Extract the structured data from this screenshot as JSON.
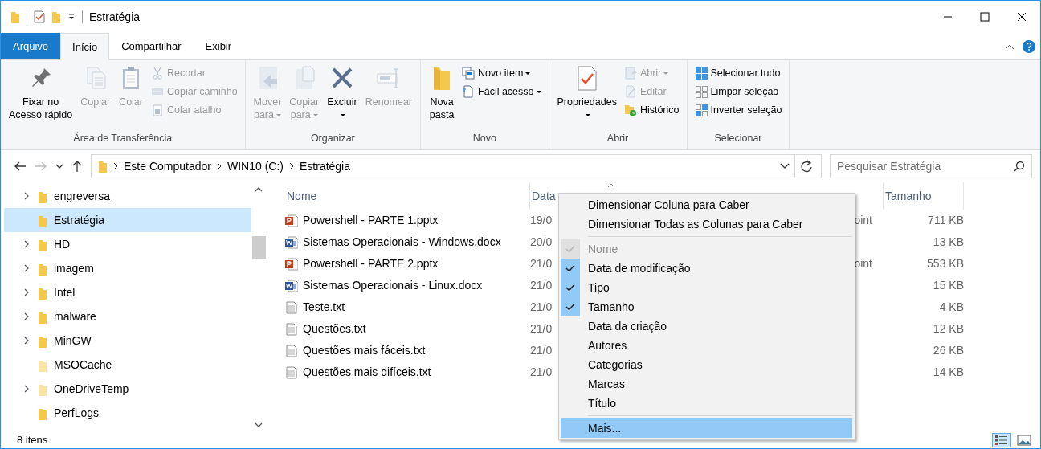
{
  "window": {
    "title": "Estratégia"
  },
  "ribbon_tabs": [
    {
      "label": "Arquivo",
      "kind": "file",
      "selected": false
    },
    {
      "label": "Início",
      "kind": "tab",
      "selected": true
    },
    {
      "label": "Compartilhar",
      "kind": "tab",
      "selected": false
    },
    {
      "label": "Exibir",
      "kind": "tab",
      "selected": false
    }
  ],
  "ribbon_groups": [
    {
      "name": "Área de Transferência",
      "items": [
        {
          "kind": "large",
          "label": "Fixar no\nAcesso rápido",
          "disabled": false,
          "dropdown": false
        },
        {
          "kind": "large",
          "label": "Copiar",
          "disabled": true,
          "dropdown": false
        },
        {
          "kind": "large",
          "label": "Colar",
          "disabled": true,
          "dropdown": false
        },
        {
          "kind": "small",
          "label": "Recortar",
          "disabled": true,
          "dropdown": false
        },
        {
          "kind": "small",
          "label": "Copiar caminho",
          "disabled": true,
          "dropdown": false
        },
        {
          "kind": "small",
          "label": "Colar atalho",
          "disabled": true,
          "dropdown": false
        }
      ]
    },
    {
      "name": "Organizar",
      "items": [
        {
          "kind": "large",
          "label": "Mover\npara",
          "disabled": true,
          "dropdown": true
        },
        {
          "kind": "large",
          "label": "Copiar\npara",
          "disabled": true,
          "dropdown": true
        },
        {
          "kind": "large",
          "label": "Excluir",
          "disabled": false,
          "dropdown": true
        },
        {
          "kind": "large",
          "label": "Renomear",
          "disabled": true,
          "dropdown": false
        }
      ]
    },
    {
      "name": "Novo",
      "items": [
        {
          "kind": "large",
          "label": "Nova\npasta",
          "disabled": false,
          "dropdown": false
        },
        {
          "kind": "small",
          "label": "Novo item",
          "disabled": false,
          "dropdown": true
        },
        {
          "kind": "small",
          "label": "Fácil acesso",
          "disabled": false,
          "dropdown": true
        }
      ]
    },
    {
      "name": "Abrir",
      "items": [
        {
          "kind": "large",
          "label": "Propriedades",
          "disabled": false,
          "dropdown": true
        },
        {
          "kind": "small",
          "label": "Abrir",
          "disabled": true,
          "dropdown": true
        },
        {
          "kind": "small",
          "label": "Editar",
          "disabled": true,
          "dropdown": false
        },
        {
          "kind": "small",
          "label": "Histórico",
          "disabled": false,
          "dropdown": false
        }
      ]
    },
    {
      "name": "Selecionar",
      "items": [
        {
          "kind": "small",
          "label": "Selecionar tudo",
          "disabled": false,
          "dropdown": false
        },
        {
          "kind": "small",
          "label": "Limpar seleção",
          "disabled": false,
          "dropdown": false
        },
        {
          "kind": "small",
          "label": "Inverter seleção",
          "disabled": false,
          "dropdown": false
        }
      ]
    }
  ],
  "address": {
    "crumbs": [
      "Este Computador",
      "WIN10 (C:)",
      "Estratégia"
    ],
    "search_placeholder": "Pesquisar Estratégia"
  },
  "nav_tree": [
    {
      "label": "engreversa",
      "has_children": true,
      "hidden": false,
      "selected": false
    },
    {
      "label": "Estratégia",
      "has_children": false,
      "hidden": false,
      "selected": true
    },
    {
      "label": "HD",
      "has_children": true,
      "hidden": false,
      "selected": false
    },
    {
      "label": "imagem",
      "has_children": true,
      "hidden": false,
      "selected": false
    },
    {
      "label": "Intel",
      "has_children": true,
      "hidden": false,
      "selected": false
    },
    {
      "label": "malware",
      "has_children": true,
      "hidden": false,
      "selected": false
    },
    {
      "label": "MinGW",
      "has_children": true,
      "hidden": false,
      "selected": false
    },
    {
      "label": "MSOCache",
      "has_children": false,
      "hidden": true,
      "selected": false
    },
    {
      "label": "OneDriveTemp",
      "has_children": true,
      "hidden": true,
      "selected": false
    },
    {
      "label": "PerfLogs",
      "has_children": false,
      "hidden": false,
      "selected": false
    }
  ],
  "columns": [
    "Nome",
    "Data",
    "Tamanho"
  ],
  "files": [
    {
      "kind": "pptx",
      "name": "Powershell - PARTE 1.pptx",
      "date": "19/0",
      "type": "oint",
      "size": "711 KB"
    },
    {
      "kind": "docx",
      "name": "Sistemas Operacionais  - Windows.docx",
      "date": "20/0",
      "size": "13 KB"
    },
    {
      "kind": "pptx",
      "name": "Powershell - PARTE 2.pptx",
      "date": "21/0",
      "type": "oint",
      "size": "553 KB"
    },
    {
      "kind": "docx",
      "name": "Sistemas Operacionais - Linux.docx",
      "date": "21/0",
      "size": "15 KB"
    },
    {
      "kind": "txt",
      "name": "Teste.txt",
      "date": "21/0",
      "size": "4 KB"
    },
    {
      "kind": "txt",
      "name": "Questões.txt",
      "date": "21/0",
      "size": "12 KB"
    },
    {
      "kind": "txt",
      "name": "Questões mais fáceis.txt",
      "date": "21/0",
      "size": "26 KB"
    },
    {
      "kind": "txt",
      "name": "Questões mais difíceis.txt",
      "date": "21/0",
      "size": "14 KB"
    }
  ],
  "context_menu": [
    {
      "kind": "command",
      "label": "Dimensionar Coluna para Caber",
      "checked": false,
      "disabled": false,
      "selected": false
    },
    {
      "kind": "command",
      "label": "Dimensionar Todas as Colunas para Caber",
      "checked": false,
      "disabled": false,
      "selected": false
    },
    {
      "kind": "separator"
    },
    {
      "kind": "column",
      "label": "Nome",
      "checked": true,
      "disabled": true,
      "selected": false
    },
    {
      "kind": "column",
      "label": "Data de modificação",
      "checked": true,
      "disabled": false,
      "selected": false
    },
    {
      "kind": "column",
      "label": "Tipo",
      "checked": true,
      "disabled": false,
      "selected": false
    },
    {
      "kind": "column",
      "label": "Tamanho",
      "checked": true,
      "disabled": false,
      "selected": false
    },
    {
      "kind": "column",
      "label": "Data da criação",
      "checked": false,
      "disabled": false,
      "selected": false
    },
    {
      "kind": "column",
      "label": "Autores",
      "checked": false,
      "disabled": false,
      "selected": false
    },
    {
      "kind": "column",
      "label": "Categorias",
      "checked": false,
      "disabled": false,
      "selected": false
    },
    {
      "kind": "column",
      "label": "Marcas",
      "checked": false,
      "disabled": false,
      "selected": false
    },
    {
      "kind": "column",
      "label": "Título",
      "checked": false,
      "disabled": false,
      "selected": false
    },
    {
      "kind": "separator"
    },
    {
      "kind": "command",
      "label": "Mais...",
      "checked": false,
      "disabled": false,
      "selected": true
    }
  ],
  "status_bar": {
    "count": "8 itens",
    "views": [
      {
        "kind": "details",
        "selected": true
      },
      {
        "kind": "thumbnails",
        "selected": false
      }
    ]
  }
}
